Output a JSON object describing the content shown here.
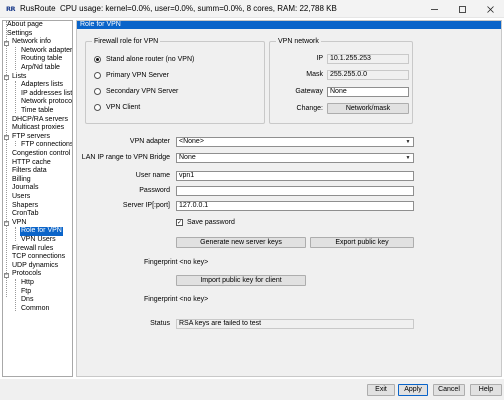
{
  "window": {
    "app_icon": "RR",
    "title": "RusRoute",
    "status_line": "CPU usage: kernel=0.0%, user=0.0%, summ=0.0%, 8 cores,  RAM: 22,788 KB",
    "minimize_icon": "minimize-icon",
    "maximize_icon": "maximize-icon",
    "close_icon": "close-icon"
  },
  "tree": {
    "items": [
      {
        "label": "About page"
      },
      {
        "label": "Settings"
      },
      {
        "label": "Network info",
        "toggle": "−"
      },
      {
        "label": "Network adapters"
      },
      {
        "label": "Routing table"
      },
      {
        "label": "Arp/Nd table"
      },
      {
        "label": "Lists",
        "toggle": "−"
      },
      {
        "label": "Adapters lists"
      },
      {
        "label": "IP addresses lists"
      },
      {
        "label": "Network protocols"
      },
      {
        "label": "Time table"
      },
      {
        "label": "DHCP/RA servers"
      },
      {
        "label": "Multicast proxies"
      },
      {
        "label": "FTP servers",
        "toggle": "−"
      },
      {
        "label": "FTP connections"
      },
      {
        "label": "Congestion control"
      },
      {
        "label": "HTTP cache"
      },
      {
        "label": "Filters data"
      },
      {
        "label": "Billing"
      },
      {
        "label": "Journals"
      },
      {
        "label": "Users"
      },
      {
        "label": "Shapers"
      },
      {
        "label": "CronTab"
      },
      {
        "label": "VPN",
        "toggle": "−"
      },
      {
        "label": "Role for VPN"
      },
      {
        "label": "VPN Users"
      },
      {
        "label": "Firewall rules"
      },
      {
        "label": "TCP connections"
      },
      {
        "label": "UDP dynamics"
      },
      {
        "label": "Protocols",
        "toggle": "−"
      },
      {
        "label": "Http"
      },
      {
        "label": "Ftp"
      },
      {
        "label": "Dns"
      },
      {
        "label": "Common"
      }
    ]
  },
  "panel": {
    "header": "Role for VPN",
    "role_group": {
      "title": "Firewall role for VPN",
      "options": [
        {
          "label": "Stand alone router (no VPN)",
          "checked": true
        },
        {
          "label": "Primary VPN Server",
          "checked": false
        },
        {
          "label": "Secondary VPN Server",
          "checked": false
        },
        {
          "label": "VPN Client",
          "checked": false
        }
      ]
    },
    "network_group": {
      "title": "VPN network",
      "ip_label": "IP",
      "ip_value": "10.1.255.253",
      "mask_label": "Mask",
      "mask_value": "255.255.0.0",
      "gateway_label": "Gateway",
      "gateway_value": "None",
      "change_label": "Change:",
      "change_button": "Network/mask"
    },
    "form": {
      "vpn_adapter_label": "VPN adapter",
      "vpn_adapter_value": "<None>",
      "lan_range_label": "LAN IP range to VPN Bridge",
      "lan_range_value": "None",
      "user_name_label": "User name",
      "user_name_value": "vpn1",
      "password_label": "Password",
      "password_value": "",
      "server_ip_label": "Server IP[:port]",
      "server_ip_value": "127.0.0.1",
      "save_password_label": "Save password",
      "save_password_checked": true,
      "generate_keys_button": "Generate new server keys",
      "export_key_button": "Export public key",
      "fingerprint1_label": "Fingerprint",
      "fingerprint1_value": "<no key>",
      "import_key_button": "Import public key for client",
      "fingerprint2_label": "Fingerprint",
      "fingerprint2_value": "<no key>",
      "status_label": "Status",
      "status_value": "RSA keys are failed to test"
    }
  },
  "bottom": {
    "exit": "Exit",
    "apply": "Apply",
    "cancel": "Cancel",
    "help": "Help"
  }
}
